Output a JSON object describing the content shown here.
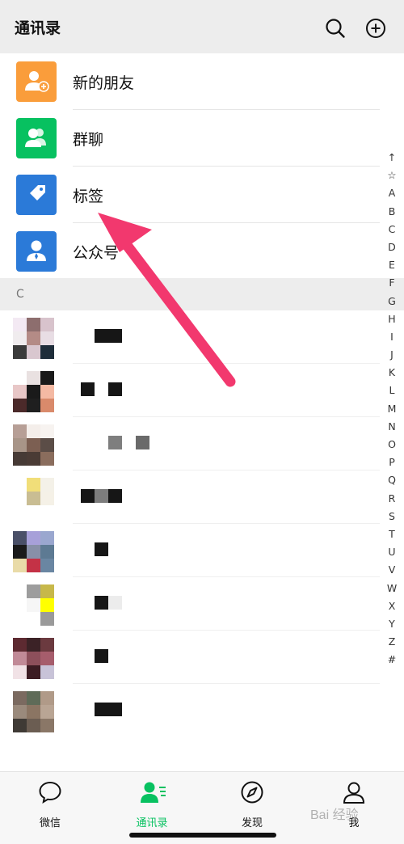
{
  "header": {
    "title": "通讯录",
    "search_icon": "search-icon",
    "add_icon": "plus-circle-icon"
  },
  "entries": [
    {
      "label": "新的朋友",
      "icon": "add-friend-icon",
      "color": "#fa9d3b"
    },
    {
      "label": "群聊",
      "icon": "group-icon",
      "color": "#07c160"
    },
    {
      "label": "标签",
      "icon": "tag-icon",
      "color": "#2b7ad8"
    },
    {
      "label": "公众号",
      "icon": "official-account-icon",
      "color": "#2b7ad8"
    }
  ],
  "section": {
    "letter": "C"
  },
  "index_bar": [
    "↑",
    "☆",
    "A",
    "B",
    "C",
    "D",
    "E",
    "F",
    "G",
    "H",
    "I",
    "J",
    "K",
    "L",
    "M",
    "N",
    "O",
    "P",
    "Q",
    "R",
    "S",
    "T",
    "U",
    "V",
    "W",
    "X",
    "Y",
    "Z",
    "#"
  ],
  "contacts": [
    {
      "avatar": [
        "#f3e9f3",
        "#8d6e6e",
        "#d8c3cc",
        "#f0ecee",
        "#b48b86",
        "#e8dde4",
        "#3b3b3b",
        "#d9c7cf",
        "#1f2d3a"
      ],
      "name": [
        "#ffffff",
        "#161616",
        "#161616"
      ]
    },
    {
      "avatar": [
        "#ffffff",
        "#e9e1e1",
        "#1a1a1a",
        "#e8c7c7",
        "#1a1a1a",
        "#f4b9a3",
        "#4b2a2a",
        "#1f1f1f",
        "#d98a6b"
      ],
      "name": [
        "#161616",
        "#ffffff",
        "#161616"
      ]
    },
    {
      "avatar": [
        "#b79f96",
        "#f4eeea",
        "#f7f3f0",
        "#a89588",
        "#7c5f52",
        "#5b4d47",
        "#463a35",
        "#4a3b35",
        "#8a6d5d"
      ],
      "name": [
        "#ffffff",
        "#ffffff",
        "#7e7e7e",
        "#ffffff",
        "#6a6a6a",
        "#ffffff"
      ]
    },
    {
      "avatar": [
        "#ffffff",
        "#f1de79",
        "#f4f1e8",
        "#ffffff",
        "#c9bd93",
        "#f5f1e7",
        "#ffffff",
        "#ffffff",
        "#ffffff"
      ],
      "name": [
        "#161616",
        "#7d7d7d",
        "#161616"
      ]
    },
    {
      "avatar": [
        "#4a5068",
        "#a7a0d9",
        "#9aa7cf",
        "#1a1a1a",
        "#8890a8",
        "#5d7a93",
        "#e9dba8",
        "#c43246",
        "#6a86a2"
      ],
      "name": [
        "#ffffff",
        "#161616",
        "#ffffff"
      ]
    },
    {
      "avatar": [
        "#ffffff",
        "#9d9d9d",
        "#c7b84a",
        "#ffffff",
        "#f6f6f6",
        "#ffff00",
        "#ffffff",
        "#ffffff",
        "#9a9a9a"
      ],
      "name": [
        "#ffffff",
        "#161616",
        "#ececec"
      ]
    },
    {
      "avatar": [
        "#5d2a31",
        "#3b2226",
        "#6b3a3f",
        "#c18a97",
        "#8d4f5b",
        "#a65d6c",
        "#f1e2e6",
        "#3c1c23",
        "#c8c3d8"
      ],
      "name": [
        "#ffffff",
        "#161616",
        "#ffffff"
      ]
    },
    {
      "avatar": [
        "#7b6a60",
        "#5f6b58",
        "#b09a88",
        "#9a8a7c",
        "#8b7563",
        "#b9a594",
        "#3f3a35",
        "#6b5d52",
        "#8a7767"
      ],
      "name": [
        "#ffffff",
        "#161616",
        "#161616"
      ]
    }
  ],
  "tabs": [
    {
      "label": "微信",
      "icon": "chat-bubble-icon",
      "active": false
    },
    {
      "label": "通讯录",
      "icon": "contacts-icon",
      "active": true
    },
    {
      "label": "发现",
      "icon": "compass-icon",
      "active": false
    },
    {
      "label": "我",
      "icon": "person-icon",
      "active": false
    }
  ],
  "overlay": {
    "arrow_color": "#f2386e",
    "watermark": "Bai 经验"
  },
  "colors": {
    "accent": "#07c160",
    "header_bg": "#ededed"
  }
}
